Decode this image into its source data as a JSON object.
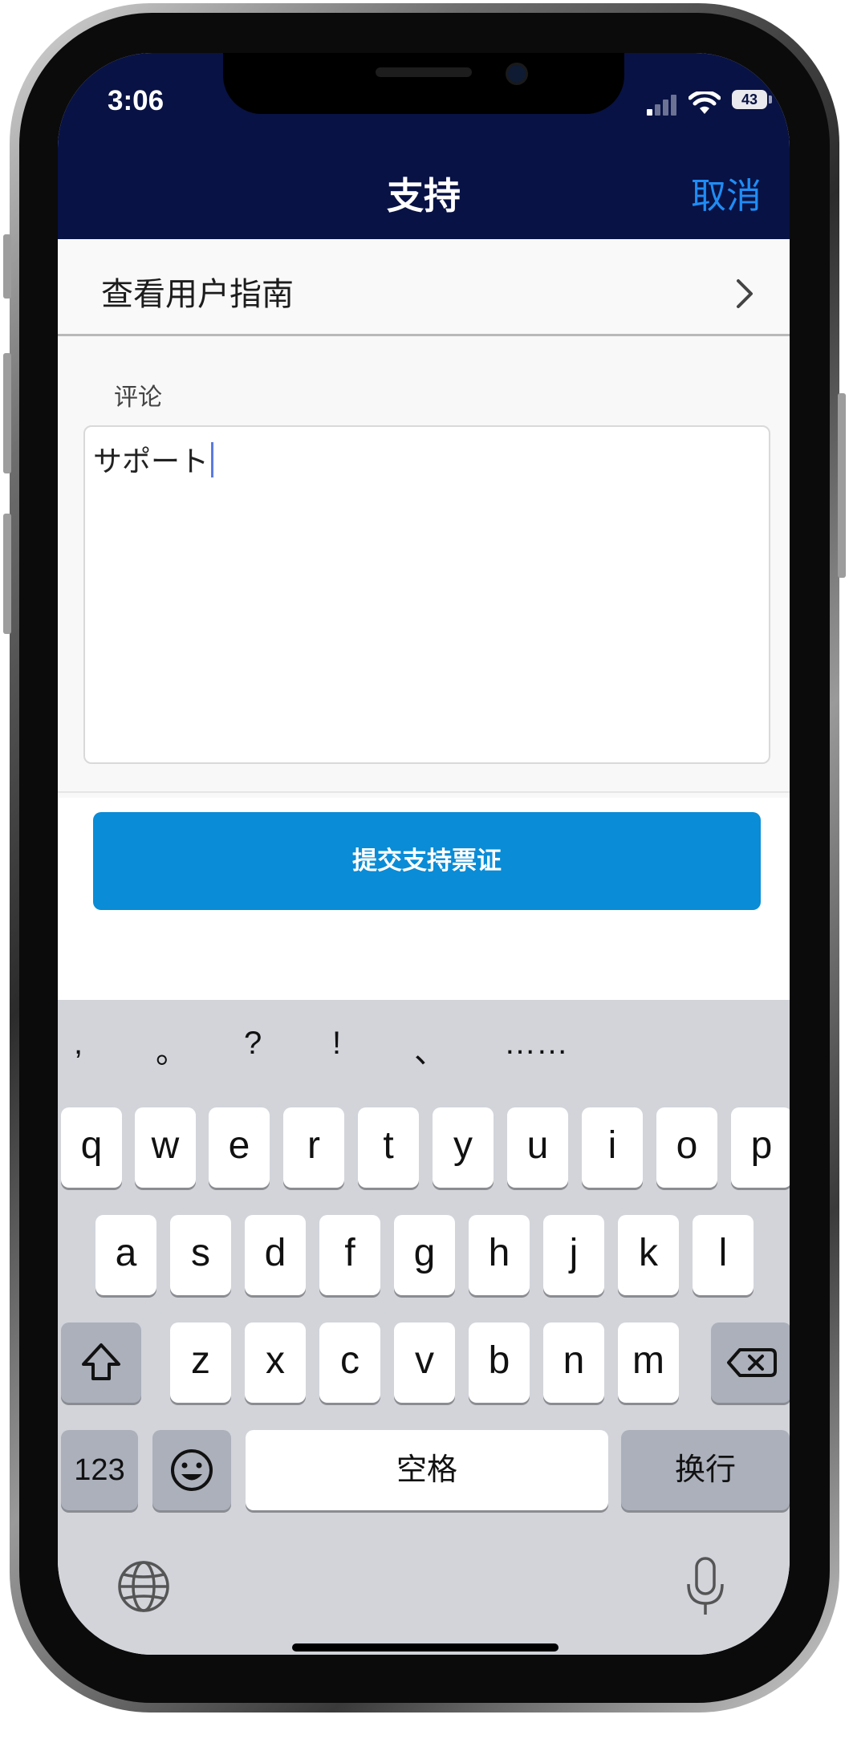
{
  "status_bar": {
    "time": "3:06",
    "battery": "43"
  },
  "nav": {
    "title": "支持",
    "cancel_label": "取消"
  },
  "guide_row": {
    "label": "查看用户指南"
  },
  "comment": {
    "label": "评论",
    "value": "サポート"
  },
  "submit": {
    "label": "提交支持票证"
  },
  "keyboard": {
    "punctuation": [
      ",",
      "。",
      "?",
      "!",
      "、",
      "……"
    ],
    "row1": [
      "q",
      "w",
      "e",
      "r",
      "t",
      "y",
      "u",
      "i",
      "o",
      "p"
    ],
    "row2": [
      "a",
      "s",
      "d",
      "f",
      "g",
      "h",
      "j",
      "k",
      "l"
    ],
    "row3": [
      "z",
      "x",
      "c",
      "v",
      "b",
      "n",
      "m"
    ],
    "numbers_label": "123",
    "space_label": "空格",
    "return_label": "换行",
    "icons": [
      "shift-icon",
      "backspace-icon",
      "emoji-icon",
      "globe-icon",
      "microphone-icon"
    ]
  }
}
